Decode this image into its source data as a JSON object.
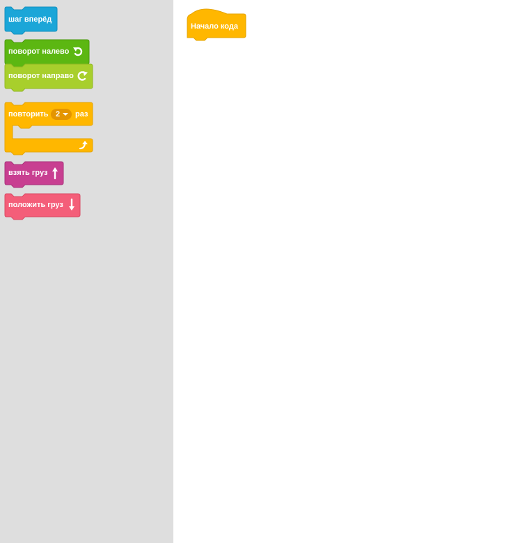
{
  "toolbox": {
    "blocks": {
      "move_forward": {
        "label": "шаг вперёд",
        "color": "#1ba6d8"
      },
      "turn_left": {
        "label": "поворот налево",
        "color": "#5cb712",
        "icon": "turn-left-icon"
      },
      "turn_right": {
        "label": "поворот направо",
        "color": "#a8cf2c",
        "icon": "turn-right-icon"
      },
      "repeat": {
        "label_before": "повторить",
        "count": "2",
        "label_after": "раз",
        "color": "#ffb700",
        "icon": "loop-arrow-icon"
      },
      "pick_up": {
        "label": "взять груз",
        "color": "#c83f91",
        "icon": "arrow-up-icon"
      },
      "put_down": {
        "label": "положить груз",
        "color": "#f45e79",
        "icon": "arrow-down-icon"
      }
    }
  },
  "workspace": {
    "start_block": {
      "label": "Начало кода",
      "color": "#ffb700"
    }
  }
}
